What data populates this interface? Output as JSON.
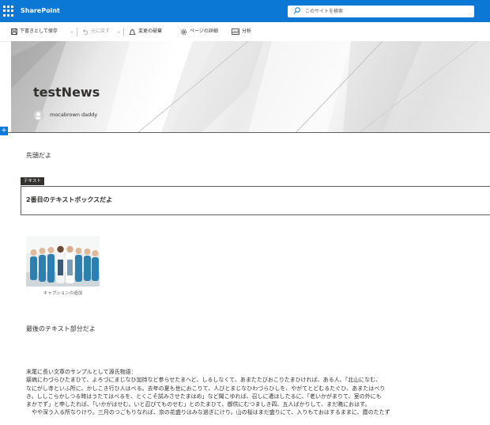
{
  "suite_bar": {
    "app_name": "SharePoint",
    "search_placeholder": "このサイトを検索",
    "bg_color": "#0a78d4"
  },
  "command_bar": {
    "save_draft": "下書きとして保存",
    "undo": "元に戻す",
    "discard": "変更の破棄",
    "page_details": "ページの詳細",
    "analytics": "分析"
  },
  "header": {
    "title": "testNews",
    "author": "mocabrown daddy"
  },
  "content": {
    "first_text": "先頭だよ",
    "webpart_tag": "テキスト",
    "second_textbox": "2番目のテキストボックスだよ",
    "image_caption": "キャプションの追加",
    "last_text": "最後のテキスト部分だよ",
    "long_text": [
      "末尾に長い文章のサンプルとして源氏物語：",
      "瘧病にわづらひたまひて、よろづにまじなひ加持など参らせたまへど、しるしなくて、あまたたびおこりたまひければ、ある人、「北山になむ、",
      "なにがし寺といふ所に、かしこき行ひ人はべる。去年の夏も世におこりて、人びとまじなひわづらひしを、やがてとどむるたぐひ、あまたはべり",
      "き。ししこらかしつる時はうたてはべるを、とくこそ試みさせたまはめ」など聞こゆれば、召しに遣はしたるに、「老いかがまりて、室の外にも",
      "まかでず」と申したれば、「いかがはせむ。いと忍びてものせむ」とのたまひて、御供にむつましき四、五人ばかりして、まだ暁におはす。",
      "　やや深う入る所なりけり。三月のつごもりなれば、京の花盛りはみな過ぎにけり。山の桜はまだ盛りにて、入りもておはするままに、霞のたたず"
    ]
  }
}
